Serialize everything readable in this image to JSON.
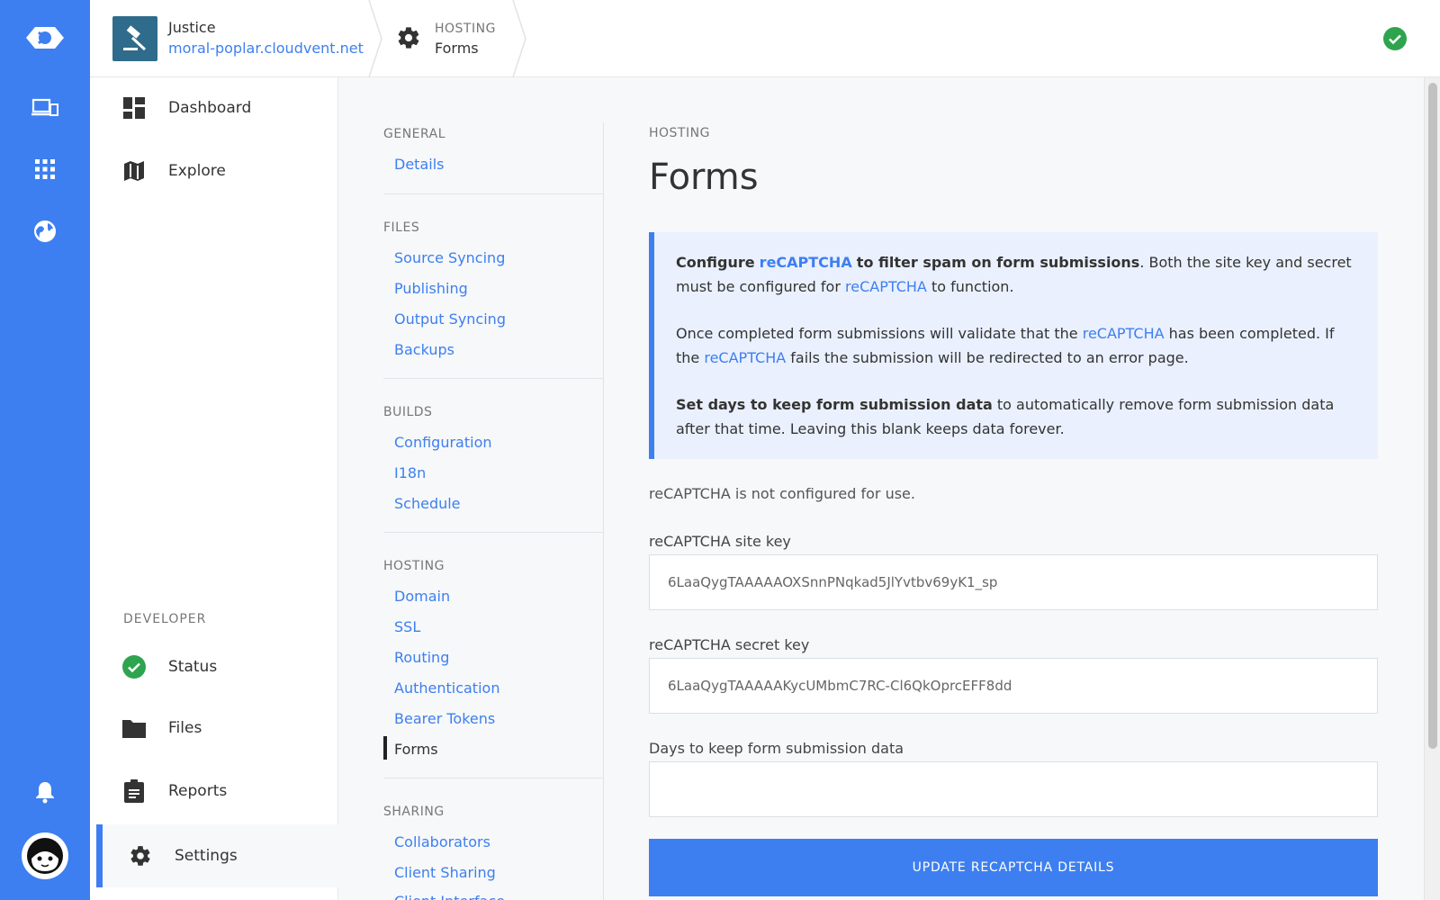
{
  "colors": {
    "accent": "#3d7ff0",
    "success": "#2ea44f",
    "rail": "#3d7ff0"
  },
  "rail": {
    "icons": [
      "cloud-logo-icon",
      "devices-icon",
      "apps-grid-icon",
      "globe-icon",
      "bell-icon",
      "avatar-icon"
    ]
  },
  "header": {
    "site_name": "Justice",
    "site_url": "moral-poplar.cloudvent.net",
    "crumb_section": "HOSTING",
    "crumb_page": "Forms"
  },
  "leftnav": {
    "items": [
      {
        "label": "Dashboard",
        "icon": "dashboard-icon"
      },
      {
        "label": "Explore",
        "icon": "map-icon"
      }
    ],
    "developer_heading": "DEVELOPER",
    "developer_items": [
      {
        "label": "Status",
        "icon": "check-circle-icon"
      },
      {
        "label": "Files",
        "icon": "folder-icon"
      },
      {
        "label": "Reports",
        "icon": "clipboard-icon"
      },
      {
        "label": "Settings",
        "icon": "gear-icon"
      }
    ]
  },
  "subnav": {
    "general": {
      "heading": "GENERAL",
      "links": [
        "Details"
      ]
    },
    "files": {
      "heading": "FILES",
      "links": [
        "Source Syncing",
        "Publishing",
        "Output Syncing",
        "Backups"
      ]
    },
    "builds": {
      "heading": "BUILDS",
      "links": [
        "Configuration",
        "I18n",
        "Schedule"
      ]
    },
    "hosting": {
      "heading": "HOSTING",
      "links": [
        "Domain",
        "SSL",
        "Routing",
        "Authentication",
        "Bearer Tokens",
        "Forms"
      ]
    },
    "sharing": {
      "heading": "SHARING",
      "links": [
        "Collaborators",
        "Client Sharing",
        "Client Interface"
      ]
    },
    "active": "Forms"
  },
  "main": {
    "eyebrow": "HOSTING",
    "title": "Forms",
    "info": {
      "p1_configure": "Configure",
      "p1_recaptcha": "reCAPTCHA",
      "p1_bold_rest": "to filter spam on form submissions",
      "p1_rest": ". Both the site key and secret must be configured for",
      "p1_recaptcha2": "reCAPTCHA",
      "p1_end": "to function.",
      "p2_start": "Once completed form submissions will validate that the",
      "p2_recaptcha": "reCAPTCHA",
      "p2_mid": "has been completed. If the",
      "p2_recaptcha2": "reCAPTCHA",
      "p2_end": "fails the submission will be redirected to an error page.",
      "p3_bold": "Set days to keep form submission data",
      "p3_rest": "to automatically remove form submission data after that time. Leaving this blank keeps data forever."
    },
    "status_note": "reCAPTCHA is not configured for use.",
    "site_key_label": "reCAPTCHA site key",
    "site_key_value": "6LaaQygTAAAAAOXSnnPNqkad5JlYvtbv69yK1_sp",
    "secret_key_label": "reCAPTCHA secret key",
    "secret_key_value": "6LaaQygTAAAAAKycUMbmC7RC-Cl6QkOprcEFF8dd",
    "days_label": "Days to keep form submission data",
    "days_value": "",
    "button_label": "UPDATE RECAPTCHA DETAILS"
  }
}
